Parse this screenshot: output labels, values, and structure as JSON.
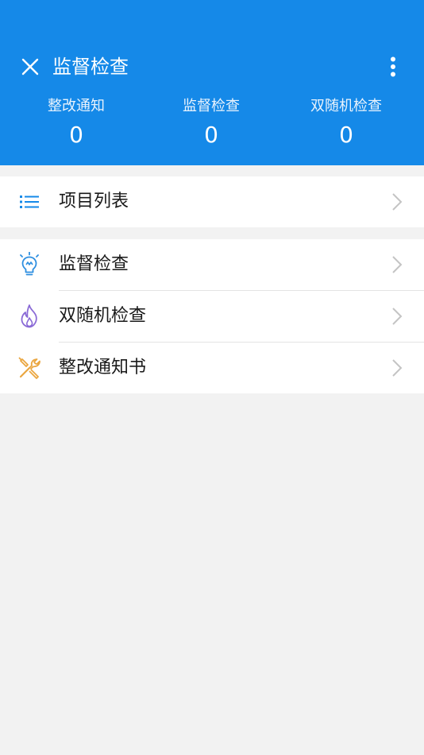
{
  "header": {
    "title": "监督检查",
    "background_color": "#1589e8",
    "close_icon": "close-icon",
    "more_icon": "more-vertical-icon"
  },
  "stats": [
    {
      "label": "整改通知",
      "value": "0"
    },
    {
      "label": "监督检查",
      "value": "0"
    },
    {
      "label": "双随机检查",
      "value": "0"
    }
  ],
  "menu": {
    "project_list": {
      "label": "项目列表",
      "icon": "list-icon",
      "icon_color": "#1589e8"
    },
    "items": [
      {
        "label": "监督检查",
        "icon": "lightbulb-icon",
        "icon_color": "#2d8ee0"
      },
      {
        "label": "双随机检查",
        "icon": "flame-icon",
        "icon_color": "#8a6ad6"
      },
      {
        "label": "整改通知书",
        "icon": "tools-icon",
        "icon_color": "#eaa640"
      }
    ]
  }
}
